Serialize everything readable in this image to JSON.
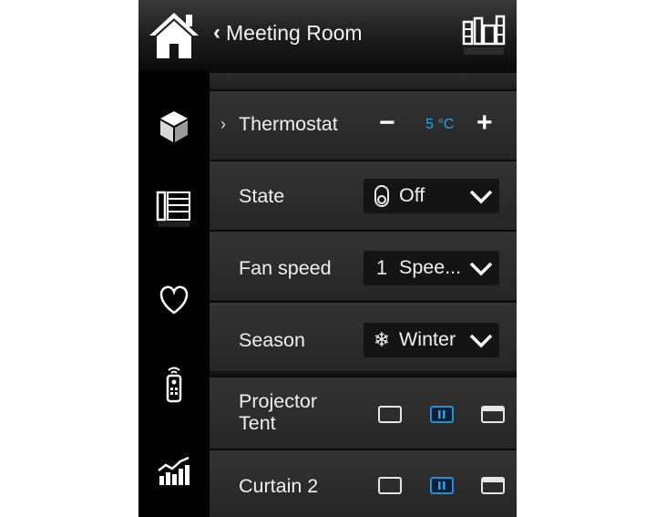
{
  "header": {
    "title": "Meeting Room",
    "home_icon": "home-icon",
    "rooms_icon": "rooms-grid-icon"
  },
  "sidebar": {
    "items": [
      {
        "icon": "cube-icon"
      },
      {
        "icon": "list-icon"
      },
      {
        "icon": "heart-icon"
      },
      {
        "icon": "remote-icon"
      },
      {
        "icon": "chart-icon"
      }
    ]
  },
  "thermostat": {
    "label": "Thermostat",
    "minus": "−",
    "value": "5 °C",
    "plus": "+"
  },
  "state": {
    "label": "State",
    "value": "Off"
  },
  "fan": {
    "label": "Fan speed",
    "icon_text": "1",
    "value": "Spee..."
  },
  "season": {
    "label": "Season",
    "icon_text": "❄",
    "value": "Winter"
  },
  "projector_tent": {
    "label_line1": "Projector",
    "label_line2": "Tent"
  },
  "curtain2": {
    "label": "Curtain 2"
  },
  "colors": {
    "accent": "#2ea3e6",
    "background": "#121212"
  }
}
